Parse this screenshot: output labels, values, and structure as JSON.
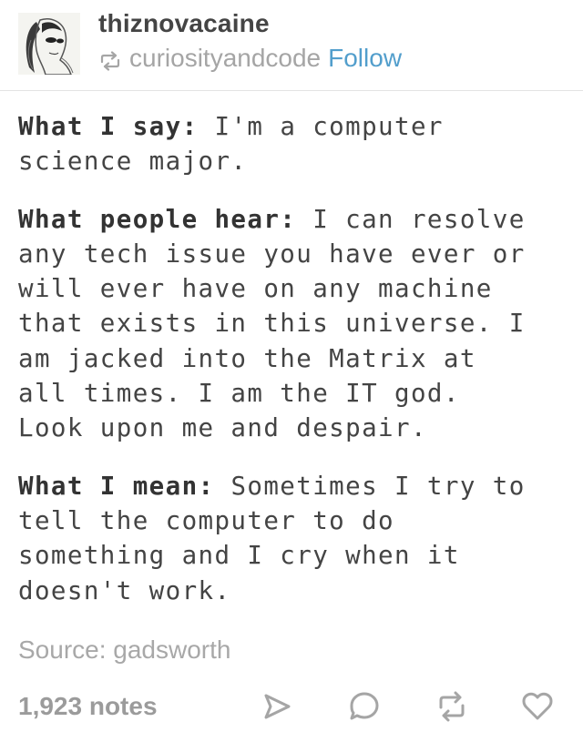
{
  "post": {
    "username": "thiznovacaine",
    "reblogged_from": "curiosityandcode",
    "follow_label": "Follow",
    "paragraphs": [
      {
        "label": "What I say:",
        "text": " I'm a computer\nscience major."
      },
      {
        "label": "What people hear:",
        "text": " I can resolve\nany tech issue you have ever or\nwill ever have on any machine\nthat exists in this universe. I\nam jacked into the Matrix at\nall times. I am the IT god.\nLook upon me and despair."
      },
      {
        "label": "What I mean:",
        "text": " Sometimes I try to\ntell the computer to do\nsomething and I cry when it\ndoesn't work."
      }
    ],
    "source": "Source: gadsworth",
    "notes": "1,923 notes"
  },
  "colors": {
    "link": "#529ecc",
    "muted": "#a5a5a5",
    "text": "#444444"
  },
  "icons": {
    "share": "share-icon",
    "reply": "reply-icon",
    "reblog": "reblog-icon",
    "like": "heart-icon"
  }
}
